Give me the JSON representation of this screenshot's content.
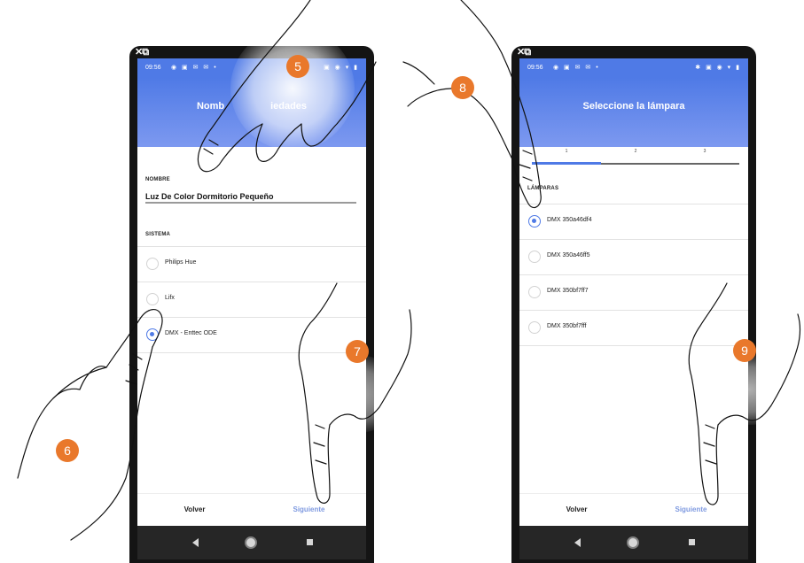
{
  "left_phone": {
    "status_time": "09:56",
    "header_title": "Nomb                 iedades",
    "name_label": "NOMBRE",
    "name_value": "Luz De Color Dormitorio Pequeño",
    "system_label": "SISTEMA",
    "options": [
      {
        "label": "Philips Hue",
        "selected": false
      },
      {
        "label": "Lifx",
        "selected": false
      },
      {
        "label": "DMX - Enttec ODE",
        "selected": true
      }
    ],
    "back_label": "Volver",
    "next_label": "Siguiente"
  },
  "right_phone": {
    "status_time": "09:56",
    "header_title": "Seleccione la lámpara",
    "steps": [
      "1",
      "2",
      "3"
    ],
    "active_step": 1,
    "lamps_label": "LÁMPARAS",
    "lamps": [
      {
        "label": "DMX 350a46df4",
        "selected": true
      },
      {
        "label": "DMX 350a46ff5",
        "selected": false
      },
      {
        "label": "DMX 350bf7ff7",
        "selected": false
      },
      {
        "label": "DMX 350bf7fff",
        "selected": false
      }
    ],
    "back_label": "Volver",
    "next_label": "Siguiente"
  },
  "badges": [
    "5",
    "6",
    "7",
    "8",
    "9"
  ],
  "colors": {
    "accent": "#4f7ae6",
    "badge": "#e9782b",
    "next_text": "#7f9ae0"
  }
}
